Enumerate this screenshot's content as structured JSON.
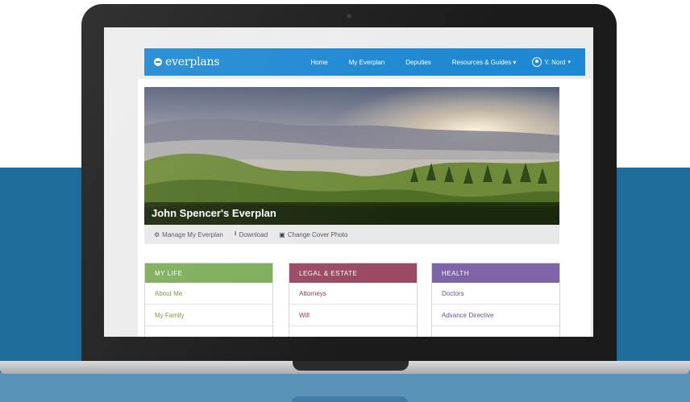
{
  "app": {
    "logo_text": "everplans",
    "logo_icon": "everplans-logo-icon"
  },
  "nav": {
    "items": [
      "Home",
      "My Everplan",
      "Deputies",
      "Resources & Guides ▾"
    ],
    "user_label": "Y. Nord"
  },
  "cover": {
    "title": "John Spencer's Everplan"
  },
  "actions": [
    {
      "icon": "gear-icon",
      "glyph": "⚙",
      "label": "Manage My Everplan"
    },
    {
      "icon": "download-icon",
      "glyph": "⭳",
      "label": "Download"
    },
    {
      "icon": "photo-icon",
      "glyph": "▣",
      "label": "Change Cover Photo"
    }
  ],
  "cards": [
    {
      "title": "MY LIFE",
      "color": "#7fae5a",
      "link_color": "#6a9a3a",
      "items": [
        "About Me",
        "My Family"
      ]
    },
    {
      "title": "LEGAL & ESTATE",
      "color": "#9c4a64",
      "link_color": "#8a3a55",
      "items": [
        "Attorneys",
        "Will"
      ]
    },
    {
      "title": "HEALTH",
      "color": "#7e64a8",
      "link_color": "#6a4f94",
      "items": [
        "Doctors",
        "Advance Directive"
      ]
    }
  ],
  "colors": {
    "nav_blue": "#1e88d2",
    "background_blue": "#1f6c9b"
  }
}
